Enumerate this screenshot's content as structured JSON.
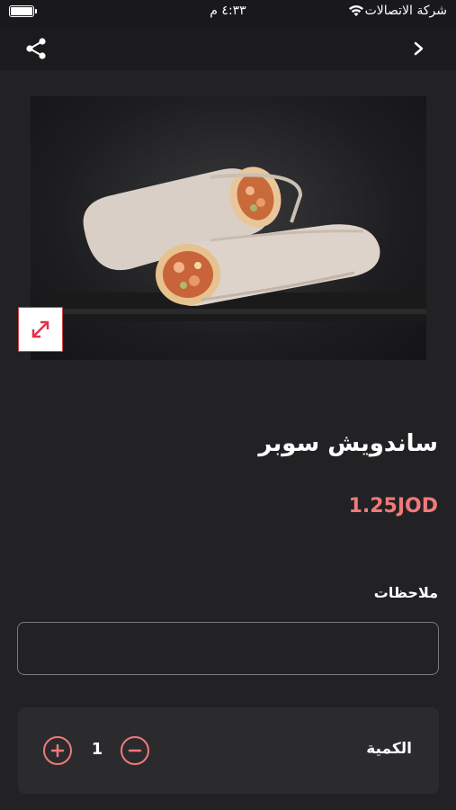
{
  "status_bar": {
    "carrier": "شركة الاتصالات",
    "time": "٤:٣٣ م",
    "battery_icon": "battery-icon",
    "wifi_icon": "wifi-icon"
  },
  "nav": {
    "share_icon": "share-icon",
    "back_icon": "chevron-right-icon"
  },
  "product": {
    "image_icon": "food-photo",
    "expand_icon": "expand-icon",
    "title": "ساندويش سوبر",
    "price": "1.25JOD"
  },
  "notes": {
    "label": "ملاحظات",
    "value": "",
    "placeholder": ""
  },
  "quantity": {
    "label": "الكمية",
    "value": "1",
    "plus_icon": "plus-circle-icon",
    "minus_icon": "minus-circle-icon"
  },
  "colors": {
    "background": "#222225",
    "accent": "#f07a7a",
    "panel": "#2b2b2e"
  }
}
